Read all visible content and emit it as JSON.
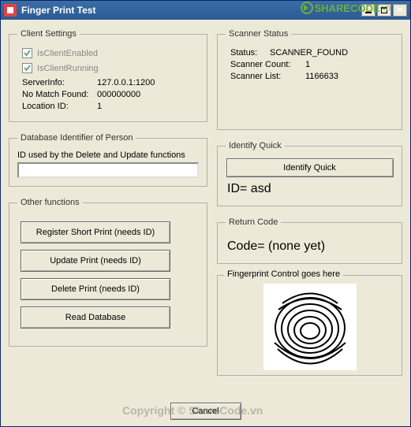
{
  "window": {
    "title": "Finger Print Test"
  },
  "clientSettings": {
    "legend": "Client Settings",
    "isEnabledLabel": "IsClientEnabled",
    "isRunningLabel": "IsClientRunning",
    "serverInfoLabel": "ServerInfo:",
    "serverInfoValue": "127.0.0.1:1200",
    "noMatchLabel": "No Match Found:",
    "noMatchValue": "000000000",
    "locationIdLabel": "Location ID:",
    "locationIdValue": "1"
  },
  "scannerStatus": {
    "legend": "Scanner Status",
    "statusLabel": "Status:",
    "statusValue": "SCANNER_FOUND",
    "countLabel": "Scanner Count:",
    "countValue": "1",
    "listLabel": "Scanner List:",
    "listValue": "1166633"
  },
  "dbId": {
    "legend": "Database Identifier of Person",
    "hint": "ID used by the Delete and Update functions"
  },
  "identify": {
    "legend": "Identify Quick",
    "button": "Identify Quick",
    "result": "ID=  asd"
  },
  "other": {
    "legend": "Other functions",
    "register": "Register Short Print (needs ID)",
    "update": "Update Print (needs ID)",
    "delete": "Delete Print (needs ID)",
    "read": "Read Database"
  },
  "return": {
    "legend": "Return Code",
    "value": "Code= (none yet)"
  },
  "fingerprint": {
    "legend": "Fingerprint Control goes here"
  },
  "footer": {
    "cancel": "Cancel"
  },
  "watermark": {
    "logo": "SHARECODE",
    "suffix": ".vn",
    "copyright": "Copyright © ShareCode.vn",
    "overlay": "ShareCode.vn"
  }
}
